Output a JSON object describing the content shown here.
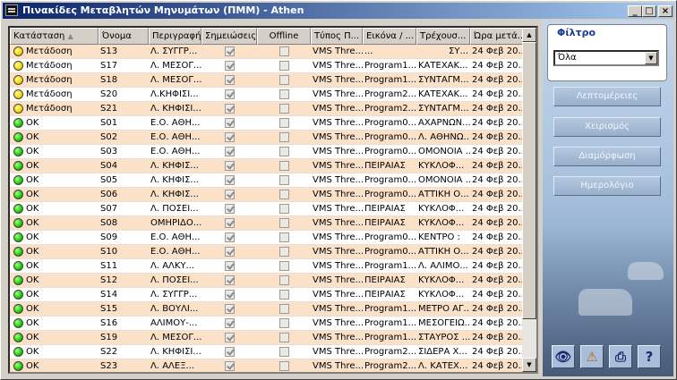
{
  "window": {
    "title": "Πινακίδες Μεταβλητών Μηνυμάτων (ΠΜΜ) - Athen",
    "minimize_label": "_",
    "maximize_label": "□",
    "close_label": "×"
  },
  "table": {
    "columns": [
      "Κατάσταση",
      "Όνομα",
      "Περιγραφή",
      "Σημειώσεις",
      "Offline",
      "Τύπος Π...",
      "Εικόνα / ...",
      "Τρέχουσ...",
      "Ώρα μετά..."
    ],
    "sort_indicator": "▲",
    "rows": [
      {
        "status": "yellow",
        "state": "Μετάδοση",
        "name": "S13",
        "desc": "Λ. ΣΥΓΓΡ...",
        "notes": true,
        "offline": false,
        "type": "VMS Thre...",
        "image": "...",
        "current": "ΣΥ...",
        "time": "24 Φεβ 20..."
      },
      {
        "status": "yellow",
        "state": "Μετάδοση",
        "name": "S17",
        "desc": "Λ. ΜΕΣΟΓ...",
        "notes": true,
        "offline": false,
        "type": "VMS Thre...",
        "image": "Program1...",
        "current": "ΚΑΤΕΧΑΚ...",
        "time": "24 Φεβ 20..."
      },
      {
        "status": "yellow",
        "state": "Μετάδοση",
        "name": "S18",
        "desc": "Λ. ΜΕΣΟΓ...",
        "notes": true,
        "offline": false,
        "type": "VMS Thre...",
        "image": "Program1...",
        "current": "ΣΥΝΤΑΓΜ...",
        "time": "24 Φεβ 20..."
      },
      {
        "status": "yellow",
        "state": "Μετάδοση",
        "name": "S20",
        "desc": "Λ.ΚΗΦΙΣΙ...",
        "notes": true,
        "offline": false,
        "type": "VMS Thre...",
        "image": "Program2...",
        "current": "ΚΑΤΕΧΑΚ...",
        "time": "24 Φεβ 20..."
      },
      {
        "status": "yellow",
        "state": "Μετάδοση",
        "name": "S21",
        "desc": "Λ. ΚΗΦΙΣΙ...",
        "notes": true,
        "offline": false,
        "type": "VMS Thre...",
        "image": "Program2...",
        "current": "ΣΥΝΤΑΓΜ...",
        "time": "24 Φεβ 20..."
      },
      {
        "status": "green",
        "state": "OK",
        "name": "S01",
        "desc": "Ε.Ο. ΑΘΗ...",
        "notes": true,
        "offline": false,
        "type": "VMS Thre...",
        "image": "Program0...",
        "current": "ΑΧΑΡΝΩΝ...",
        "time": "24 Φεβ 20..."
      },
      {
        "status": "green",
        "state": "OK",
        "name": "S02",
        "desc": "Ε.Ο. ΑΘΗ...",
        "notes": true,
        "offline": false,
        "type": "VMS Thre...",
        "image": "Program0...",
        "current": "Λ. ΑΘΗΝΩ...",
        "time": "24 Φεβ 20..."
      },
      {
        "status": "green",
        "state": "OK",
        "name": "S03",
        "desc": "Ε.Ο. ΑΘΗ...",
        "notes": true,
        "offline": false,
        "type": "VMS Thre...",
        "image": "Program0...",
        "current": "ΟΜΟΝΟΙΑ ...",
        "time": "24 Φεβ 20..."
      },
      {
        "status": "green",
        "state": "OK",
        "name": "S04",
        "desc": "Λ. ΚΗΦΙΣ...",
        "notes": true,
        "offline": false,
        "type": "VMS Thre...",
        "image": "ΠΕΙΡΑΙΑΣ",
        "current": "ΚΥΚΛΟΦ...",
        "time": "24 Φεβ 20..."
      },
      {
        "status": "green",
        "state": "OK",
        "name": "S05",
        "desc": "Λ. ΚΗΦΙΣ...",
        "notes": true,
        "offline": false,
        "type": "VMS Thre...",
        "image": "Program0...",
        "current": "ΟΜΟΝΟΙΑ ...",
        "time": "24 Φεβ 20..."
      },
      {
        "status": "green",
        "state": "OK",
        "name": "S06",
        "desc": "Λ. ΚΗΦΙΣ...",
        "notes": true,
        "offline": false,
        "type": "VMS Thre...",
        "image": "Program0...",
        "current": "ΑΤΤΙΚΗ Ο...",
        "time": "24 Φεβ 20..."
      },
      {
        "status": "green",
        "state": "OK",
        "name": "S07",
        "desc": "Λ. ΠΟΣΕΙ...",
        "notes": true,
        "offline": false,
        "type": "VMS Thre...",
        "image": "ΠΕΙΡΑΙΑΣ",
        "current": "ΚΥΚΛΟΦ...",
        "time": "24 Φεβ 20..."
      },
      {
        "status": "green",
        "state": "OK",
        "name": "S08",
        "desc": "ΟΜΗΡΙΔΟ...",
        "notes": true,
        "offline": false,
        "type": "VMS Thre...",
        "image": "ΠΕΙΡΑΙΑΣ",
        "current": "ΚΥΚΛΟΦ...",
        "time": "24 Φεβ 20..."
      },
      {
        "status": "green",
        "state": "OK",
        "name": "S09",
        "desc": "Ε.Ο. ΑΘΗ...",
        "notes": true,
        "offline": false,
        "type": "VMS Thre...",
        "image": "Program0...",
        "current": "ΚΕΝΤΡΟ :",
        "time": "24 Φεβ 20..."
      },
      {
        "status": "green",
        "state": "OK",
        "name": "S10",
        "desc": "Ε.Ο. ΑΘΗ...",
        "notes": true,
        "offline": false,
        "type": "VMS Thre...",
        "image": "Program0...",
        "current": "ΑΤΤΙΚΗ Ο...",
        "time": "24 Φεβ 20..."
      },
      {
        "status": "green",
        "state": "OK",
        "name": "S11",
        "desc": "Λ. ΑΛΚΥ...",
        "notes": true,
        "offline": false,
        "type": "VMS Thre...",
        "image": "Program1...",
        "current": "Λ. ΑΛΙΜΟ...",
        "time": "24 Φεβ 20..."
      },
      {
        "status": "green",
        "state": "OK",
        "name": "S12",
        "desc": "Λ. ΠΟΣΕΙ...",
        "notes": true,
        "offline": false,
        "type": "VMS Thre...",
        "image": "ΠΕΙΡΑΙΑΣ",
        "current": "ΚΥΚΛΟΦ...",
        "time": "24 Φεβ 20..."
      },
      {
        "status": "green",
        "state": "OK",
        "name": "S14",
        "desc": "Λ. ΣΥΓΓΡ...",
        "notes": true,
        "offline": false,
        "type": "VMS Thre...",
        "image": "ΠΕΙΡΑΙΑΣ",
        "current": "ΚΥΚΛΟΦ...",
        "time": "24 Φεβ 20..."
      },
      {
        "status": "green",
        "state": "OK",
        "name": "S15",
        "desc": "Λ. ΒΟΥΛΙ...",
        "notes": true,
        "offline": false,
        "type": "VMS Thre...",
        "image": "Program1...",
        "current": "ΜΕΤΡΟ ΑΓ...",
        "time": "24 Φεβ 20..."
      },
      {
        "status": "green",
        "state": "OK",
        "name": "S16",
        "desc": "ΑΛΙΜΟΥ-...",
        "notes": true,
        "offline": false,
        "type": "VMS Thre...",
        "image": "Program1...",
        "current": "ΜΕΣΟΓΕΙΩ...",
        "time": "24 Φεβ 20..."
      },
      {
        "status": "green",
        "state": "OK",
        "name": "S19",
        "desc": "Λ. ΜΕΣΟΓ...",
        "notes": true,
        "offline": false,
        "type": "VMS Thre...",
        "image": "Program1...",
        "current": "ΣΤΑΥΡΟΣ ...",
        "time": "24 Φεβ 20..."
      },
      {
        "status": "green",
        "state": "OK",
        "name": "S22",
        "desc": "Λ. ΚΗΦΙΣΙ...",
        "notes": true,
        "offline": false,
        "type": "VMS Thre...",
        "image": "Program2...",
        "current": "ΣΙΔΕΡΑ Χ...",
        "time": "24 Φεβ 20..."
      },
      {
        "status": "green",
        "state": "OK",
        "name": "S23",
        "desc": "Λ. ΑΛΕΞ...",
        "notes": true,
        "offline": false,
        "type": "VMS Thre...",
        "image": "Program2...",
        "current": "Λ. ΚΑΤΕΧ...",
        "time": "24 Φεβ 20..."
      }
    ]
  },
  "sidebar": {
    "filter_legend": "Φίλτρο",
    "filter_value": "Όλα",
    "buttons": [
      "Λεπτομέρειες",
      "Χειρισμός",
      "Διαμόρφωση",
      "Ημερολόγιο"
    ],
    "tools": [
      {
        "icon": "binoculars-icon",
        "glyph": "👁"
      },
      {
        "icon": "database-warning-icon",
        "glyph": "⚠"
      },
      {
        "icon": "printer-icon",
        "glyph": "⎙"
      },
      {
        "icon": "help-icon",
        "glyph": "?"
      }
    ]
  },
  "colors": {
    "status_yellow": "#f0d800",
    "status_green": "#18c800",
    "row_alt": "#fbe1c8",
    "titlebar": "#0a246a"
  }
}
